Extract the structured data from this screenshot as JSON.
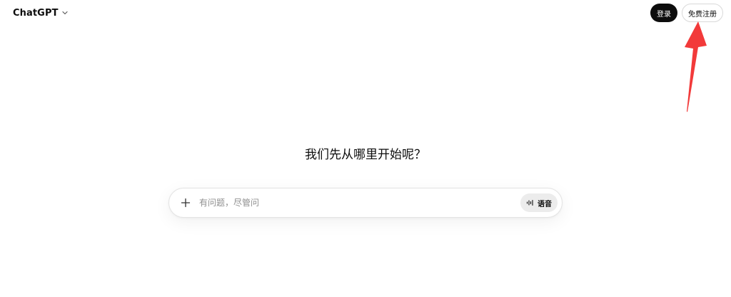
{
  "header": {
    "brand": "ChatGPT",
    "login_label": "登录",
    "signup_label": "免费注册"
  },
  "main": {
    "headline": "我们先从哪里开始呢？",
    "composer": {
      "placeholder": "有问题，尽管问",
      "value": "",
      "voice_label": "语音"
    }
  },
  "icons": {
    "brand_menu": "chevron-down-icon",
    "attach": "plus-icon",
    "voice": "waveform-icon",
    "annotation": "red-arrow-icon"
  },
  "colors": {
    "primary_button_bg": "#0d0d0d",
    "voice_button_bg": "#ececec",
    "annotation_arrow": "#f23a3a"
  }
}
